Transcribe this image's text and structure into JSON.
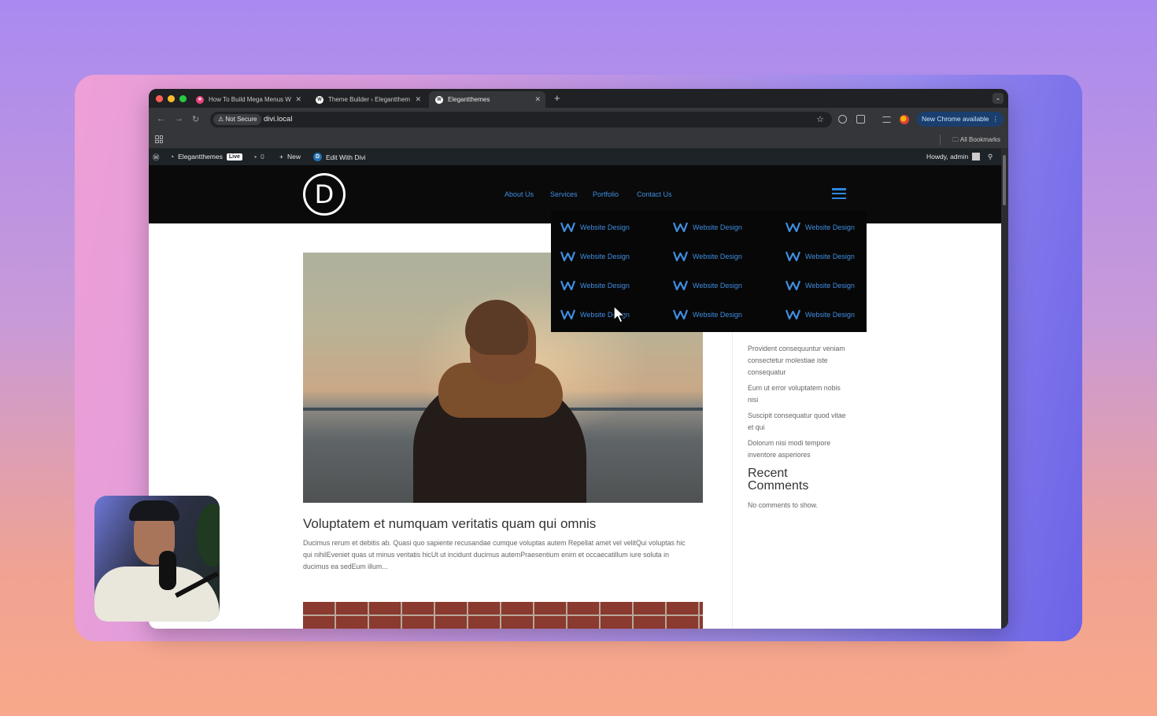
{
  "browser": {
    "tabs": [
      {
        "title": "How To Build Mega Menus W",
        "favicon": "#e8417a"
      },
      {
        "title": "Theme Builder ‹ Elegantthem",
        "favicon": "#ffffff"
      },
      {
        "title": "Elegantthemes",
        "favicon": "#ffffff"
      }
    ],
    "new_tab": "+",
    "not_secure": "Not Secure",
    "url": "divi.local",
    "new_chrome": "New Chrome available",
    "all_bookmarks": "All Bookmarks"
  },
  "adminbar": {
    "site_name": "Elegantthemes",
    "live": "Live",
    "comments": "0",
    "new": "New",
    "edit_divi": "Edit With Divi",
    "howdy": "Howdy, admin"
  },
  "site": {
    "logo_letter": "D",
    "menu": [
      "About Us",
      "Services",
      "Portfolio",
      "Contact Us"
    ],
    "accent_color": "#3f8ee0"
  },
  "mega_menu": {
    "items": [
      "Website Design",
      "Website Design",
      "Website Design",
      "Website Design",
      "Website Design",
      "Website Design",
      "Website Design",
      "Website Design",
      "Website Design",
      "Website Design",
      "Website Design",
      "Website Design"
    ]
  },
  "post": {
    "title": "Voluptatem et numquam veritatis quam qui omnis",
    "excerpt": "Ducimus rerum et debitis ab. Quasi quo sapiente recusandae cumque voluptas autem Repellat amet vel velitQui voluptas hic qui nihilEveniet quas ut minus veritatis hicUt ut incidunt ducimus autemPraesentium enim et occaecatillum iure soluta in ducimus ea sedEum illum..."
  },
  "sidebar": {
    "recent_posts": [
      "Provident consequuntur veniam consectetur molestiae iste consequatur",
      "Eum ut error voluptatem nobis nisi",
      "Suscipit consequatur quod vitae et qui",
      "Dolorum nisi modi tempore inventore asperiores"
    ],
    "recent_comments_title": "Recent Comments",
    "no_comments": "No comments to show."
  }
}
